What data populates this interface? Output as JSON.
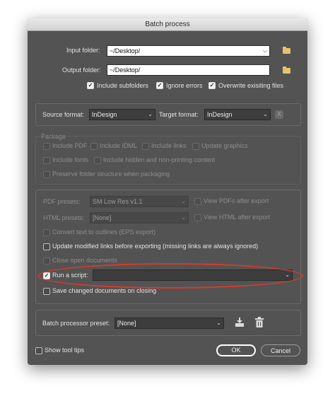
{
  "window": {
    "title": "Batch process"
  },
  "folders": {
    "input_label": "Input folder:",
    "input_value": "~/Desktop/",
    "output_label": "Output folder:",
    "output_value": "~/Desktop/",
    "include_subfolders": "Include subfolders",
    "ignore_errors": "Ignore errors",
    "overwrite": "Overwrite exisiting files"
  },
  "formats": {
    "source_label": "Source format:",
    "source_value": "InDesign",
    "target_label": "Target format:",
    "target_value": "InDesign",
    "remove_glyph": "X"
  },
  "package": {
    "title": "Package",
    "include_pdf": "Include PDF",
    "include_idml": "Include IDML",
    "include_links": "Include links",
    "update_graphics": "Update graphics",
    "include_fonts": "Include fonts",
    "include_hidden": "Include hidden and non-printing content",
    "preserve_structure": "Preserve folder structure when packaging"
  },
  "export": {
    "pdf_presets_label": "PDF presets:",
    "pdf_presets_value": "SM Low Res v1.1",
    "view_pdfs": "View PDFs after export",
    "html_presets_label": "HTML presets:",
    "html_presets_value": "[None]",
    "view_html": "View HTML after export",
    "convert_outlines": "Convert text to outlines (EPS export)",
    "update_links": "Update modified links before exporting (missing links are always ignored)",
    "close_docs": "Close open documents",
    "run_script": "Run a script:",
    "run_script_value": "",
    "save_changed": "Save changed documents on closing"
  },
  "preset": {
    "label": "Batch processor preset:",
    "value": "[None]"
  },
  "footer": {
    "show_tool_tips": "Show tool tips",
    "ok": "OK",
    "cancel": "Cancel"
  },
  "icons": {
    "folder": "folder-icon",
    "save_preset": "save-preset-icon",
    "delete_preset": "trash-icon",
    "dropdown": "chevron-down-icon",
    "checkmark": "checkmark-icon"
  },
  "colors": {
    "dialog_bg": "#535353",
    "highlight_ellipse": "#d83a2c",
    "folder_icon": "#e8c36a"
  },
  "checkbox_states": {
    "include_subfolders": true,
    "ignore_errors": true,
    "overwrite": true,
    "update_links": false,
    "run_script": true,
    "save_changed": false,
    "show_tool_tips": false
  }
}
